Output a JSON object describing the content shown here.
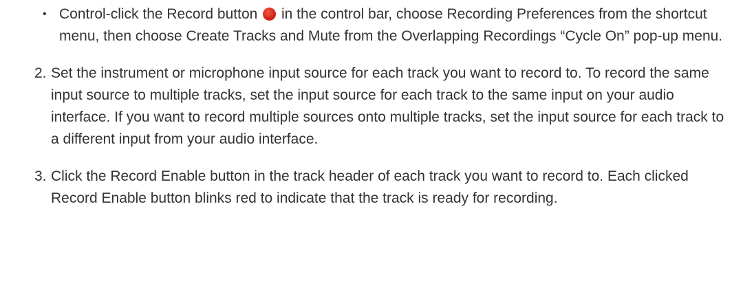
{
  "bullet": {
    "marker": "•",
    "text_before_icon": "Control-click the Record button ",
    "icon": "record-button-icon",
    "icon_color": "#d3271a",
    "text_after_icon": " in the control bar, choose Recording Preferences from the shortcut menu, then choose Create Tracks and Mute from the Overlapping Recordings “Cycle On” pop-up menu."
  },
  "steps": [
    {
      "number": "2.",
      "text": "Set the instrument or microphone input source for each track you want to record to. To record the same input source to multiple tracks, set the input source for each track to the same input on your audio interface. If you want to record multiple sources onto multiple tracks, set the input source for each track to a different input from your audio interface."
    },
    {
      "number": "3.",
      "text": "Click the Record Enable button in the track header of each track you want to record to. Each clicked Record Enable button blinks red to indicate that the track is ready for recording."
    }
  ]
}
